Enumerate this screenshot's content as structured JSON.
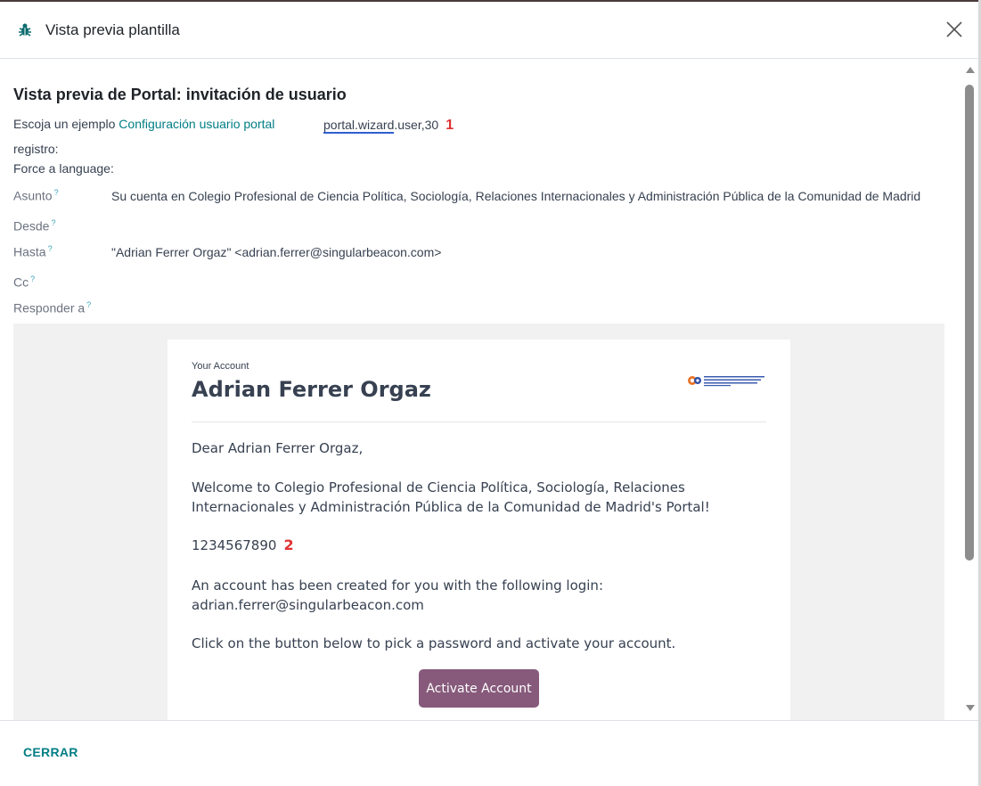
{
  "header": {
    "title": "Vista previa plantilla"
  },
  "form": {
    "section_title": "Vista previa de Portal: invitación de usuario",
    "example_label": "Escoja un ejemplo",
    "example_model": "Configuración usuario portal",
    "example_label_cont": "registro:",
    "record_ref_part1": "portal.wizard",
    "record_ref_part2": ".user,30",
    "annotation_1": "1",
    "force_language_label": "Force a language:",
    "subject_label": "Asunto",
    "subject_value": "Su cuenta en Colegio Profesional de Ciencia Política, Sociología, Relaciones Internacionales y Administración Pública de la Comunidad de Madrid",
    "from_label": "Desde",
    "to_label": "Hasta",
    "to_value": "\"Adrian Ferrer Orgaz\" <adrian.ferrer@singularbeacon.com>",
    "cc_label": "Cc",
    "reply_to_label": "Responder a",
    "help_mark": "?"
  },
  "email": {
    "your_account": "Your Account",
    "name": "Adrian Ferrer Orgaz",
    "greeting": "Dear Adrian Ferrer Orgaz,",
    "welcome": "Welcome to Colegio Profesional de Ciencia Política, Sociología, Relaciones Internacionales y Administración Pública de la Comunidad de Madrid's Portal!",
    "code": "1234567890",
    "annotation_2": "2",
    "account_created": "An account has been created for you with the following login:",
    "login": "adrian.ferrer@singularbeacon.com",
    "instructions": "Click on the button below to pick a password and activate your account.",
    "activate_label": "Activate Account"
  },
  "footer": {
    "close_label": "CERRAR"
  },
  "colors": {
    "teal": "#017e84",
    "button_purple": "#875a7b",
    "annotation_red": "#e03232"
  }
}
